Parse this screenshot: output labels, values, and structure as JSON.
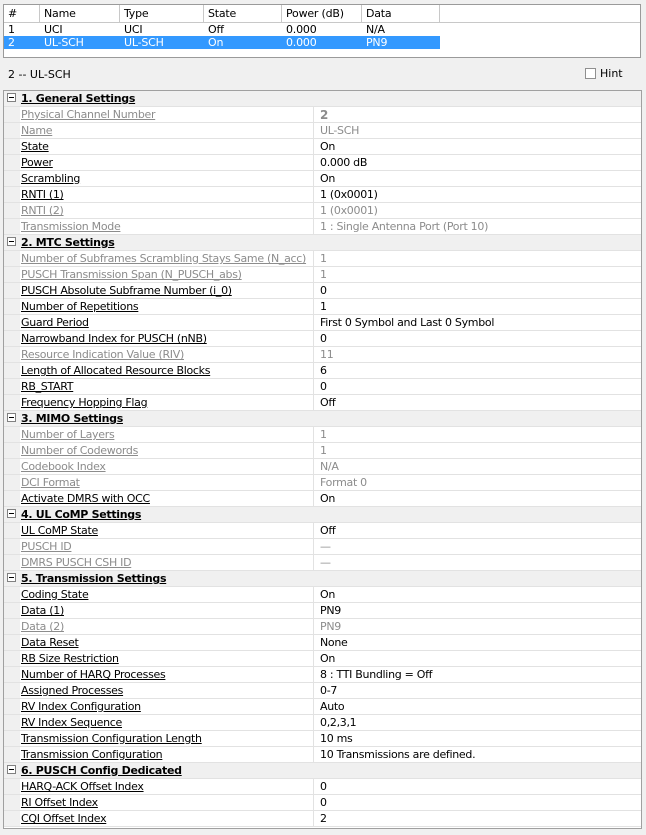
{
  "channel_table": {
    "headers": [
      "#",
      "Name",
      "Type",
      "State",
      "Power (dB)",
      "Data"
    ],
    "rows": [
      [
        "1",
        "UCI",
        "UCI",
        "Off",
        "0.000",
        "N/A"
      ],
      [
        "2",
        "UL-SCH",
        "UL-SCH",
        "On",
        "0.000",
        "PN9"
      ]
    ],
    "selected_row": 2
  },
  "sub_header": {
    "title": "2 -- UL-SCH",
    "hint_label": "Hint"
  },
  "settings": [
    {
      "type": "section",
      "label": "1. General Settings"
    },
    {
      "name": "Physical Channel Number",
      "value": "2",
      "disabled": true,
      "bold": true
    },
    {
      "name": "Name",
      "value": "UL-SCH",
      "disabled": true
    },
    {
      "name": "State",
      "value": "On"
    },
    {
      "name": "Power",
      "value": "0.000 dB"
    },
    {
      "name": "Scrambling",
      "value": "On"
    },
    {
      "name": "RNTI (1)",
      "value": "1 (0x0001)"
    },
    {
      "name": "RNTI (2)",
      "value": "1 (0x0001)",
      "disabled": true
    },
    {
      "name": "Transmission Mode",
      "value": "1 : Single Antenna Port (Port 10)",
      "disabled": true
    },
    {
      "type": "section",
      "label": "2. MTC Settings"
    },
    {
      "name": "Number of Subframes Scrambling Stays Same (N_acc)",
      "value": "1",
      "disabled": true
    },
    {
      "name": "PUSCH Transmission Span (N_PUSCH_abs)",
      "value": "1",
      "disabled": true
    },
    {
      "name": "PUSCH Absolute Subframe Number (i_0)",
      "value": "0"
    },
    {
      "name": "Number of Repetitions",
      "value": "1"
    },
    {
      "name": "Guard Period",
      "value": "First 0 Symbol  and Last 0 Symbol"
    },
    {
      "name": "Narrowband Index for PUSCH (nNB)",
      "value": "0"
    },
    {
      "name": "Resource Indication Value (RIV)",
      "value": "11",
      "disabled": true
    },
    {
      "name": "Length of Allocated Resource Blocks",
      "value": "6"
    },
    {
      "name": "RB_START",
      "value": "0"
    },
    {
      "name": "Frequency Hopping Flag",
      "value": "Off"
    },
    {
      "type": "section",
      "label": "3. MIMO Settings"
    },
    {
      "name": "Number of Layers",
      "value": "1",
      "disabled": true
    },
    {
      "name": "Number of Codewords",
      "value": "1",
      "disabled": true
    },
    {
      "name": "Codebook Index",
      "value": "N/A",
      "disabled": true
    },
    {
      "name": "DCI Format",
      "value": "Format 0",
      "disabled": true
    },
    {
      "name": "Activate DMRS with OCC",
      "value": "On"
    },
    {
      "type": "section",
      "label": "4. UL CoMP Settings"
    },
    {
      "name": "UL CoMP State",
      "value": "Off"
    },
    {
      "name": "PUSCH ID",
      "value": "—",
      "disabled": true
    },
    {
      "name": "DMRS PUSCH CSH ID",
      "value": "—",
      "disabled": true
    },
    {
      "type": "section",
      "label": "5. Transmission Settings"
    },
    {
      "name": "Coding State",
      "value": "On"
    },
    {
      "name": "Data (1)",
      "value": "PN9"
    },
    {
      "name": "Data (2)",
      "value": "PN9",
      "disabled": true
    },
    {
      "name": "Data Reset",
      "value": "None"
    },
    {
      "name": "RB Size Restriction",
      "value": "On"
    },
    {
      "name": "Number of HARQ Processes",
      "value": "8 : TTI Bundling = Off"
    },
    {
      "name": "Assigned Processes",
      "value": "0-7"
    },
    {
      "name": "RV Index Configuration",
      "value": "Auto"
    },
    {
      "name": "RV Index Sequence",
      "value": "0,2,3,1"
    },
    {
      "name": "Transmission Configuration Length",
      "value": "10 ms"
    },
    {
      "name": "Transmission Configuration",
      "value": "10 Transmissions are defined."
    },
    {
      "type": "section",
      "label": "6. PUSCH Config Dedicated"
    },
    {
      "name": "HARQ-ACK Offset Index",
      "value": "0"
    },
    {
      "name": "RI Offset Index",
      "value": "0"
    },
    {
      "name": "CQI Offset Index",
      "value": "2"
    }
  ]
}
